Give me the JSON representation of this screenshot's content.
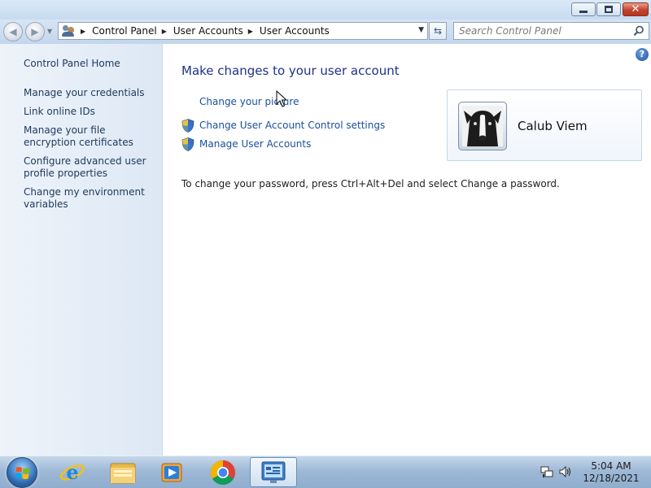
{
  "window": {
    "controls": [
      "minimize",
      "maximize",
      "close"
    ]
  },
  "navigation": {
    "breadcrumb": [
      "Control Panel",
      "User Accounts",
      "User Accounts"
    ],
    "search_placeholder": "Search Control Panel"
  },
  "sidebar": {
    "home": "Control Panel Home",
    "links": [
      "Manage your credentials",
      "Link online IDs",
      "Manage your file encryption certificates",
      "Configure advanced user profile properties",
      "Change my environment variables"
    ]
  },
  "main": {
    "title": "Make changes to your user account",
    "tasks": [
      "Change your picture",
      "Change User Account Control settings",
      "Manage User Accounts"
    ],
    "password_note": "To change your password, press Ctrl+Alt+Del and select Change a password.",
    "user": {
      "name": "Calub Viem"
    }
  },
  "taskbar": {
    "apps": [
      "start-button",
      "internet-explorer",
      "windows-explorer",
      "media-player",
      "chrome",
      "control-panel"
    ],
    "clock": {
      "time": "5:04 AM",
      "date": "12/18/2021"
    }
  }
}
